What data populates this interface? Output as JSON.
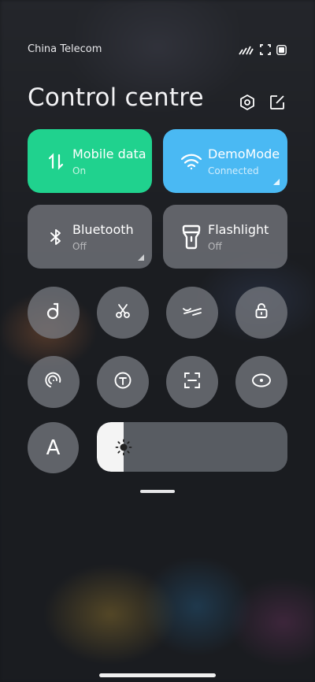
{
  "status_bar": {
    "carrier": "China Telecom",
    "icons": [
      "signal-icon",
      "screen-record-icon",
      "battery-icon"
    ]
  },
  "header": {
    "title": "Control centre",
    "buttons": [
      "settings-icon",
      "edit-icon"
    ]
  },
  "tiles": {
    "mobile_data": {
      "name": "Mobile data",
      "status": "On",
      "color": "#20d28e",
      "icon": "mobile-data-icon"
    },
    "wifi": {
      "name": "DemoMode",
      "status": "Connected",
      "color": "#4ab9f3",
      "icon": "wifi-icon"
    },
    "bluetooth": {
      "name": "Bluetooth",
      "status": "Off",
      "icon": "bluetooth-icon"
    },
    "flashlight": {
      "name": "Flashlight",
      "status": "Off",
      "icon": "flashlight-icon"
    }
  },
  "toggles_row1": [
    "dark-mode-icon",
    "scissors-icon",
    "reading-mode-icon",
    "lock-icon"
  ],
  "toggles_row2": [
    "auto-rotate-icon",
    "text-icon",
    "scan-icon",
    "eye-icon"
  ],
  "auto_brightness": {
    "label": "A"
  },
  "brightness": {
    "level": 0.14
  }
}
